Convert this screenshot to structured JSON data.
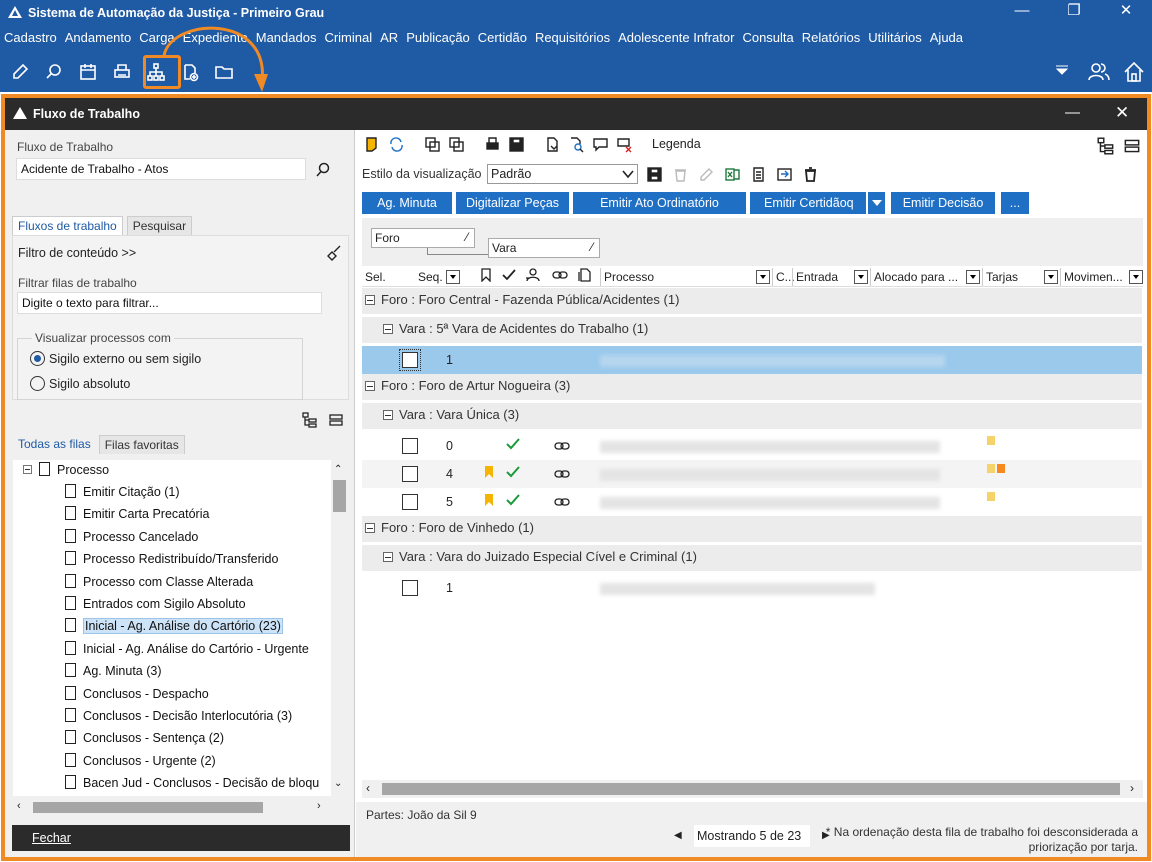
{
  "app": {
    "title": "Sistema de Automação da Justiça - Primeiro Grau",
    "menu": [
      "Cadastro",
      "Andamento",
      "Carga",
      "Expediente",
      "Mandados",
      "Criminal",
      "AR",
      "Publicação",
      "Certidão",
      "Requisitórios",
      "Adolescente Infrator",
      "Consulta",
      "Relatórios",
      "Utilitários",
      "Ajuda"
    ],
    "highlight_color": "#f08a24",
    "toolbar_icons": [
      "edit-icon",
      "search-process-icon",
      "calendar-icon",
      "printer-icon",
      "workflow-icon",
      "add-document-icon",
      "folder-icon"
    ]
  },
  "window": {
    "title": "Fluxo de Trabalho"
  },
  "left": {
    "fluxo_label": "Fluxo de Trabalho",
    "fluxo_value": "Acidente de Trabalho - Atos",
    "tabs": [
      "Fluxos de trabalho",
      "Pesquisar"
    ],
    "filtro_conteudo": "Filtro de conteúdo >>",
    "filtrar_label": "Filtrar filas de trabalho",
    "filtrar_placeholder": "Digite o texto para filtrar...",
    "visualizar_label": "Visualizar processos com",
    "radio1": "Sigilo externo ou sem sigilo",
    "radio2": "Sigilo absoluto",
    "queue_tabs": [
      "Todas as filas",
      "Filas favoritas"
    ],
    "tree_root": "Processo",
    "tree_items": [
      "Emitir Citação (1)",
      "Emitir Carta Precatória",
      "Processo Cancelado",
      "Processo Redistribuído/Transferido",
      "Processo com Classe Alterada",
      "Entrados com Sigilo Absoluto",
      "Inicial - Ag. Análise do Cartório (23)",
      "Inicial - Ag. Análise do Cartório - Urgente",
      "Ag. Minuta (3)",
      "Conclusos - Despacho",
      "Conclusos - Decisão Interlocutória (3)",
      "Conclusos - Sentença (2)",
      "Conclusos - Urgente (2)",
      "Bacen Jud - Conclusos - Decisão de bloqu"
    ],
    "selected_index": 6,
    "fechar": "Fechar"
  },
  "right": {
    "legenda": "Legenda",
    "estilo_label": "Estilo da visualização",
    "estilo_value": "Padrão",
    "actions": [
      "Ag. Minuta",
      "Digitalizar Peças",
      "Emitir Ato Ordinatório",
      "Emitir Certidãoq",
      "Emitir Decisão",
      "..."
    ],
    "group_chips": [
      "Foro",
      "Vara"
    ],
    "columns": [
      "Sel.",
      "Seq.",
      "Processo",
      "C...",
      "Entrada",
      "Alocado para ...",
      "Tarjas",
      "Movimen..."
    ],
    "groups": [
      {
        "foro": "Foro : Foro Central - Fazenda Pública/Acidentes   (1)",
        "vara": "Vara : 5ª Vara de Acidentes do Trabalho   (1)",
        "rows": [
          {
            "seq": "1"
          }
        ]
      },
      {
        "foro": "Foro : Foro de Artur Nogueira   (3)",
        "vara": "Vara : Vara Única   (3)",
        "rows": [
          {
            "seq": "0"
          },
          {
            "seq": "4"
          },
          {
            "seq": "5"
          }
        ]
      },
      {
        "foro": "Foro : Foro de Vinhedo   (1)",
        "vara": "Vara : Vara do Juizado Especial Cível e Criminal   (1)",
        "rows": [
          {
            "seq": "1"
          }
        ]
      }
    ],
    "partes": "Partes: João da Sil 9",
    "mostrando": "Mostrando 5 de 23",
    "nota": "* Na ordenação desta fila de trabalho foi desconsiderada a priorização por tarja."
  }
}
